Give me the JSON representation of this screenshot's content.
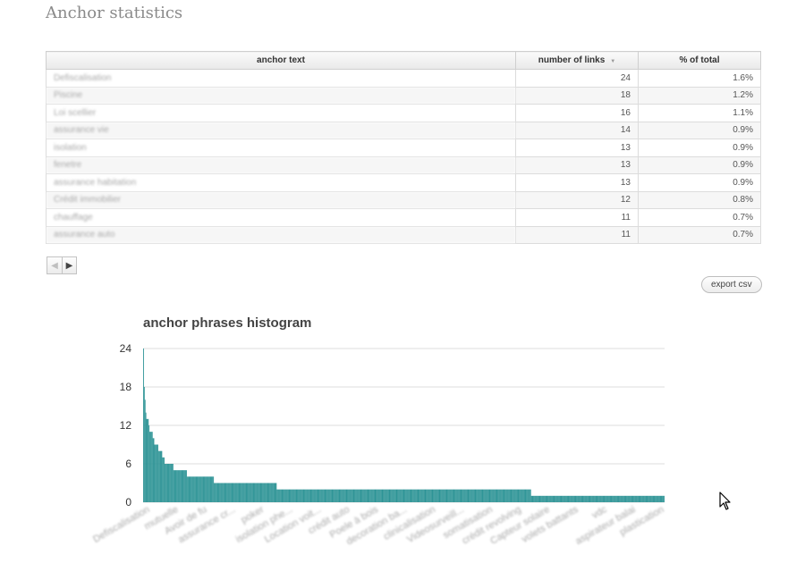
{
  "page": {
    "title": "Anchor statistics"
  },
  "table": {
    "headers": {
      "anchor": "anchor text",
      "links": "number of links",
      "pct": "% of total"
    },
    "sort_icon": "sort-descending-icon",
    "rows": [
      {
        "anchor": "Defiscalisation",
        "links": "24",
        "pct": "1.6%"
      },
      {
        "anchor": "Piscine",
        "links": "18",
        "pct": "1.2%"
      },
      {
        "anchor": "Loi scellier",
        "links": "16",
        "pct": "1.1%"
      },
      {
        "anchor": "assurance vie",
        "links": "14",
        "pct": "0.9%"
      },
      {
        "anchor": "isolation",
        "links": "13",
        "pct": "0.9%"
      },
      {
        "anchor": "fenetre",
        "links": "13",
        "pct": "0.9%"
      },
      {
        "anchor": "assurance habitation",
        "links": "13",
        "pct": "0.9%"
      },
      {
        "anchor": "Crédit immobilier",
        "links": "12",
        "pct": "0.8%"
      },
      {
        "anchor": "chauffage",
        "links": "11",
        "pct": "0.7%"
      },
      {
        "anchor": "assurance auto",
        "links": "11",
        "pct": "0.7%"
      }
    ]
  },
  "pager": {
    "prev_icon": "triangle-left-icon",
    "next_icon": "triangle-right-icon"
  },
  "export": {
    "label": "export csv"
  },
  "chart_data": {
    "type": "bar",
    "title": "anchor phrases histogram",
    "ylim": [
      0,
      24
    ],
    "yticks": [
      "0",
      "6",
      "12",
      "18",
      "24"
    ],
    "grid": true,
    "legend": "none",
    "color": "#2e9496",
    "xtick_labels": [
      "Defiscalisation",
      "mutuelle",
      "Avoir de fu",
      "assurance cr...",
      "poker",
      "isolation phe...",
      "Location voit...",
      "crédit auto",
      "Poele à bois",
      "decoration ba...",
      "clinicalisation",
      "Videosurveill...",
      "somatisation",
      "crédit revolving",
      "Capteur solaire",
      "volets battants",
      "vdc",
      "aspirateur balai",
      "plastication"
    ],
    "values": [
      24,
      18,
      16,
      14,
      13,
      13,
      13,
      12,
      11,
      11,
      11,
      11,
      10,
      10,
      9,
      9,
      9,
      9,
      9,
      8,
      8,
      8,
      8,
      8,
      7,
      7,
      7,
      6,
      6,
      6,
      6,
      6,
      6,
      6,
      6,
      6,
      6,
      6,
      5,
      5,
      5,
      5,
      5,
      5,
      5,
      5,
      5,
      5,
      5,
      5,
      5,
      5,
      5,
      5,
      5,
      4,
      4,
      4,
      4,
      4,
      4,
      4,
      4,
      4,
      4,
      4,
      4,
      4,
      4,
      4,
      4,
      4,
      4,
      4,
      4,
      4,
      4,
      4,
      4,
      4,
      4,
      4,
      4,
      4,
      4,
      4,
      4,
      4,
      4,
      3,
      3,
      3,
      3,
      3,
      3,
      3,
      3,
      3,
      3,
      3,
      3,
      3,
      3,
      3,
      3,
      3,
      3,
      3,
      3,
      3,
      3,
      3,
      3,
      3,
      3,
      3,
      3,
      3,
      3,
      3,
      3,
      3,
      3,
      3,
      3,
      3,
      3,
      3,
      3,
      3,
      3,
      3,
      3,
      3,
      3,
      3,
      3,
      3,
      3,
      3,
      3,
      3,
      3,
      3,
      3,
      3,
      3,
      3,
      3,
      3,
      3,
      3,
      3,
      3,
      3,
      3,
      3,
      3,
      3,
      3,
      3,
      3,
      3,
      3,
      3,
      3,
      3,
      3,
      2,
      2,
      2,
      2,
      2,
      2,
      2,
      2,
      2,
      2,
      2,
      2,
      2,
      2,
      2,
      2,
      2,
      2,
      2,
      2,
      2,
      2,
      2,
      2,
      2,
      2,
      2,
      2,
      2,
      2,
      2,
      2,
      2,
      2,
      2,
      2,
      2,
      2,
      2,
      2,
      2,
      2,
      2,
      2,
      2,
      2,
      2,
      2,
      2,
      2,
      2,
      2,
      2,
      2,
      2,
      2,
      2,
      2,
      2,
      2,
      2,
      2,
      2,
      2,
      2,
      2,
      2,
      2,
      2,
      2,
      2,
      2,
      2,
      2,
      2,
      2,
      2,
      2,
      2,
      2,
      2,
      2,
      2,
      2,
      2,
      2,
      2,
      2,
      2,
      2,
      2,
      2,
      2,
      2,
      2,
      2,
      2,
      2,
      2,
      2,
      2,
      2,
      2,
      2,
      2,
      2,
      2,
      2,
      2,
      2,
      2,
      2,
      2,
      2,
      2,
      2,
      2,
      2,
      2,
      2,
      2,
      2,
      2,
      2,
      2,
      2,
      2,
      2,
      2,
      2,
      2,
      2,
      2,
      2,
      2,
      2,
      2,
      2,
      2,
      2,
      2,
      2,
      2,
      2,
      2,
      2,
      2,
      2,
      2,
      2,
      2,
      2,
      2,
      2,
      2,
      2,
      2,
      2,
      2,
      2,
      2,
      2,
      2,
      2,
      2,
      2,
      2,
      2,
      2,
      2,
      2,
      2,
      2,
      2,
      2,
      2,
      2,
      2,
      2,
      2,
      2,
      2,
      2,
      2,
      2,
      2,
      2,
      2,
      2,
      2,
      2,
      2,
      2,
      2,
      2,
      2,
      2,
      2,
      2,
      2,
      2,
      2,
      2,
      2,
      2,
      2,
      2,
      2,
      2,
      2,
      2,
      2,
      2,
      2,
      2,
      2,
      2,
      2,
      2,
      2,
      2,
      2,
      2,
      2,
      2,
      2,
      2,
      2,
      2,
      2,
      2,
      2,
      2,
      2,
      2,
      2,
      2,
      2,
      2,
      2,
      2,
      2,
      2,
      2,
      2,
      2,
      2,
      2,
      2,
      2,
      2,
      2,
      2,
      2,
      2,
      2,
      2,
      2,
      2,
      2,
      2,
      2,
      2,
      2,
      2,
      2,
      2,
      2,
      2,
      2,
      2,
      2,
      2,
      2,
      2,
      2,
      2,
      2,
      2,
      2,
      2,
      2,
      2,
      2,
      2,
      2,
      2,
      2,
      2,
      2,
      2,
      2,
      2,
      2,
      2,
      2,
      2,
      2,
      2,
      2,
      2,
      2,
      2,
      2,
      2,
      2,
      2,
      2,
      2,
      2,
      2,
      2,
      2,
      2,
      2,
      2,
      2,
      2,
      2,
      2,
      1,
      1,
      1,
      1,
      1,
      1,
      1,
      1,
      1,
      1,
      1,
      1,
      1,
      1,
      1,
      1,
      1,
      1,
      1,
      1,
      1,
      1,
      1,
      1,
      1,
      1,
      1,
      1,
      1,
      1,
      1,
      1,
      1,
      1,
      1,
      1,
      1,
      1,
      1,
      1,
      1,
      1,
      1,
      1,
      1,
      1,
      1,
      1,
      1,
      1,
      1,
      1,
      1,
      1,
      1,
      1,
      1,
      1,
      1,
      1,
      1,
      1,
      1,
      1,
      1,
      1,
      1,
      1,
      1,
      1,
      1,
      1,
      1,
      1,
      1,
      1,
      1,
      1,
      1,
      1,
      1,
      1,
      1,
      1,
      1,
      1,
      1,
      1,
      1,
      1,
      1,
      1,
      1,
      1,
      1,
      1,
      1,
      1,
      1,
      1,
      1,
      1,
      1,
      1,
      1,
      1,
      1,
      1,
      1,
      1,
      1,
      1,
      1,
      1,
      1,
      1,
      1,
      1,
      1,
      1,
      1,
      1,
      1,
      1,
      1,
      1,
      1,
      1,
      1,
      1,
      1,
      1,
      1,
      1,
      1,
      1,
      1,
      1,
      1,
      1,
      1,
      1,
      1,
      1,
      1,
      1,
      1,
      1,
      1,
      1,
      1,
      1,
      1,
      1,
      1,
      1,
      1,
      1,
      1,
      1,
      1,
      1,
      1,
      1,
      1,
      1,
      1,
      1
    ]
  },
  "cursor": {
    "icon": "mouse-pointer-icon"
  }
}
